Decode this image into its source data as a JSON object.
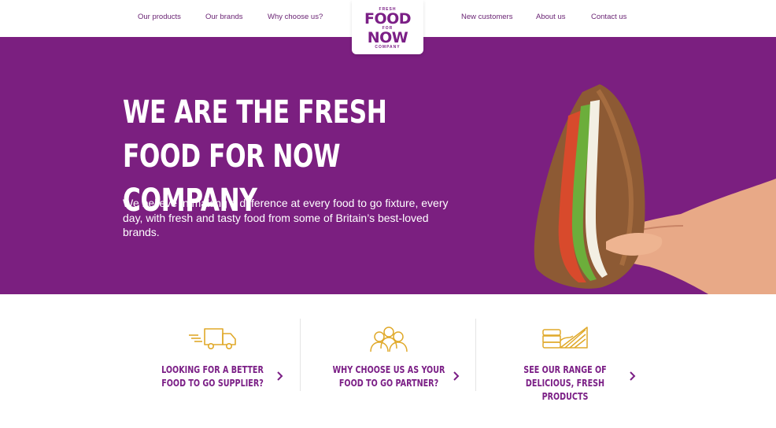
{
  "nav": {
    "products": "Our products",
    "brands": "Our brands",
    "why": "Why choose us?",
    "new_customers": "New customers",
    "about": "About us",
    "contact": "Contact us"
  },
  "logo": {
    "top": "FRESH",
    "line1": "FOOD",
    "middle": "FOR",
    "line2": "NOW",
    "bottom": "COMPANY"
  },
  "hero": {
    "title": "We are the fresh food for now company",
    "text": "We believe in making a difference at every food to go fixture, every day, with fresh and tasty food from some of Britain’s best-loved brands."
  },
  "cards": [
    {
      "title": "Looking for a better food to go supplier?",
      "icon": "delivery-truck-icon"
    },
    {
      "title": "Why choose us as your food to go partner?",
      "icon": "people-group-icon"
    },
    {
      "title": "See our range of delicious, fresh products",
      "icon": "food-products-icon"
    }
  ],
  "colors": {
    "brand_purple": "#7b1f80",
    "accent_gold": "#e0a92a",
    "white": "#ffffff"
  }
}
